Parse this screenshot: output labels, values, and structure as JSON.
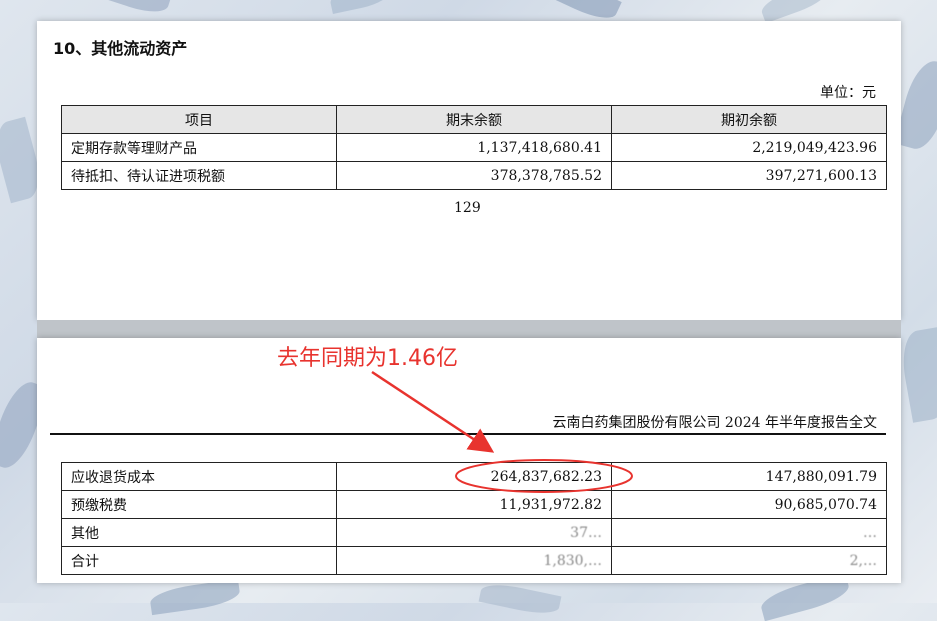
{
  "top": {
    "section_title": "10、其他流动资产",
    "unit": "单位：元",
    "headers": [
      "项目",
      "期末余额",
      "期初余额"
    ],
    "rows": [
      {
        "item": "定期存款等理财产品",
        "end": "1,137,418,680.41",
        "begin": "2,219,049,423.96"
      },
      {
        "item": "待抵扣、待认证进项税额",
        "end": "378,378,785.52",
        "begin": "397,271,600.13"
      }
    ],
    "page_number": "129"
  },
  "bottom": {
    "annotation": "去年同期为1.46亿",
    "header": "云南白药集团股份有限公司 2024 年半年度报告全文",
    "rows": [
      {
        "item": "应收退货成本",
        "end": "264,837,682.23",
        "begin": "147,880,091.79"
      },
      {
        "item": "预缴税费",
        "end": "11,931,972.82",
        "begin": "90,685,070.74"
      },
      {
        "item": "其他",
        "end": "37…",
        "begin": "…"
      },
      {
        "item": "合计",
        "end": "1,830,…",
        "begin": "2,…"
      }
    ]
  },
  "colors": {
    "annotation": "#e8332e",
    "header_fill": "#e6e6e6"
  }
}
